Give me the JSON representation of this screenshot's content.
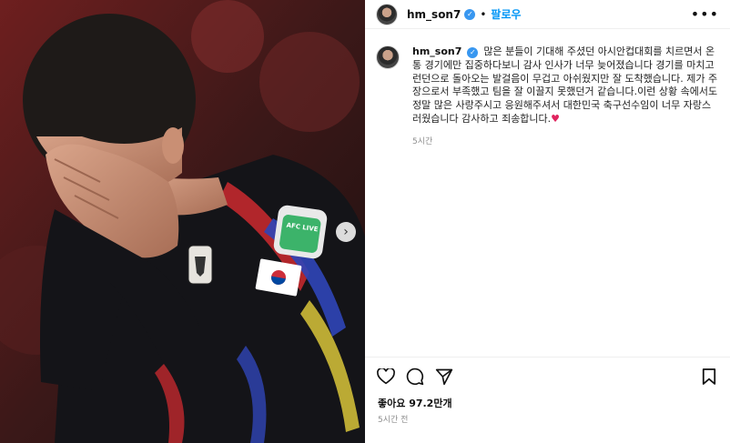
{
  "header": {
    "username": "hm_son7",
    "separator": "•",
    "follow_label": "팔로우",
    "more_label": "•••"
  },
  "post": {
    "caption_user": "hm_son7",
    "caption_text": "많은 분들이 기대해 주셨던 아시안컵대회를 치르면서 온통 경기에만 집중하다보니 감사 인사가 너무 늦어졌습니다 경기를 마치고 런던으로 돌아오는 발걸음이 무겁고 아쉬웠지만 잘 도착했습니다. 제가 주장으로서 부족했고 팀을 잘 이끌지 못했던거 같습니다.이런 상황 속에서도 정말 많은 사랑주시고 응원해주셔서  대한민국 축구선수임이 너무 자랑스러웠습니다  감사하고 죄송합니다.",
    "caption_emoji": "♥",
    "caption_time": "5시간",
    "likes": "좋아요 97.2만개",
    "posted_time": "5시간 전"
  },
  "image": {
    "patch_text": "AFC LIVE",
    "carousel_next": "›"
  },
  "icons": [
    "heart-icon",
    "comment-icon",
    "share-icon",
    "bookmark-icon",
    "verified-badge-icon",
    "more-options-icon"
  ],
  "colors": {
    "accent": "#0095f6",
    "heart": "#e0245e",
    "muted": "#8e8e8e",
    "verified": "#3897f0"
  }
}
